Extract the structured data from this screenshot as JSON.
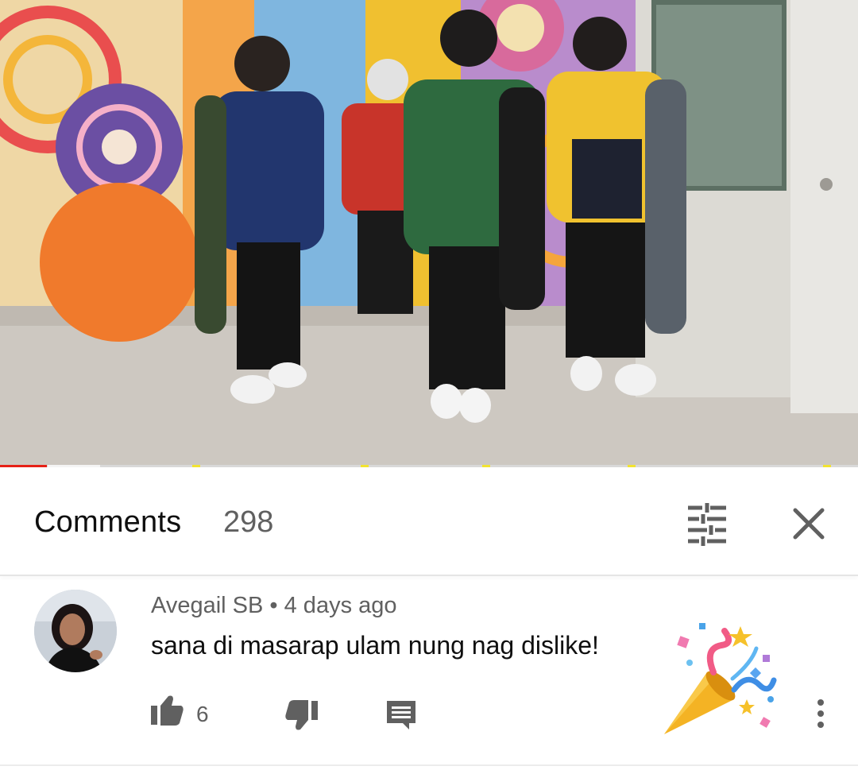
{
  "video": {
    "progress_fraction": 0.055,
    "accent_color": "#e62117"
  },
  "comments": {
    "title": "Comments",
    "count": "298",
    "sort_icon": "sort-filter-icon",
    "close_icon": "close-icon"
  },
  "comment": {
    "author": "Avegail SB",
    "separator": "•",
    "time": "4 days ago",
    "text": "sana di masarap ulam nung nag dislike!",
    "emoji": "party-popper",
    "like_count": "6",
    "like_icon": "thumbs-up-icon",
    "dislike_icon": "thumbs-down-icon",
    "reply_icon": "reply-icon",
    "menu_icon": "more-vert-icon"
  }
}
